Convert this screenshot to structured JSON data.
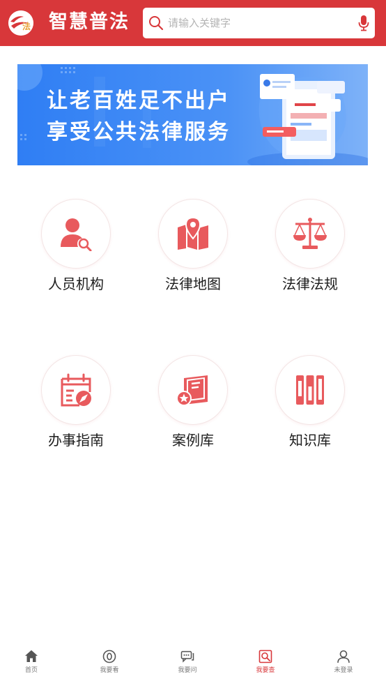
{
  "header": {
    "title": "智慧普法",
    "logo_text": "法",
    "search_placeholder": "请输入关键字"
  },
  "banner": {
    "line1": "让老百姓足不出户",
    "line2": "享受公共法律服务"
  },
  "grid": [
    {
      "label": "人员机构",
      "icon": "person-search-icon"
    },
    {
      "label": "法律地图",
      "icon": "map-pin-icon"
    },
    {
      "label": "法律法规",
      "icon": "scales-icon"
    },
    {
      "label": "办事指南",
      "icon": "calendar-compass-icon"
    },
    {
      "label": "案例库",
      "icon": "book-star-icon"
    },
    {
      "label": "知识库",
      "icon": "bookshelf-icon"
    }
  ],
  "tabs": [
    {
      "label": "首页",
      "icon": "home-icon",
      "active": false
    },
    {
      "label": "我要看",
      "icon": "eye-icon",
      "active": false
    },
    {
      "label": "我要问",
      "icon": "chat-icon",
      "active": false
    },
    {
      "label": "我要查",
      "icon": "search-doc-icon",
      "active": true
    },
    {
      "label": "未登录",
      "icon": "user-icon",
      "active": false
    }
  ],
  "colors": {
    "primary": "#d8373a",
    "icon": "#e85a5d",
    "banner": "#3a85f5"
  }
}
